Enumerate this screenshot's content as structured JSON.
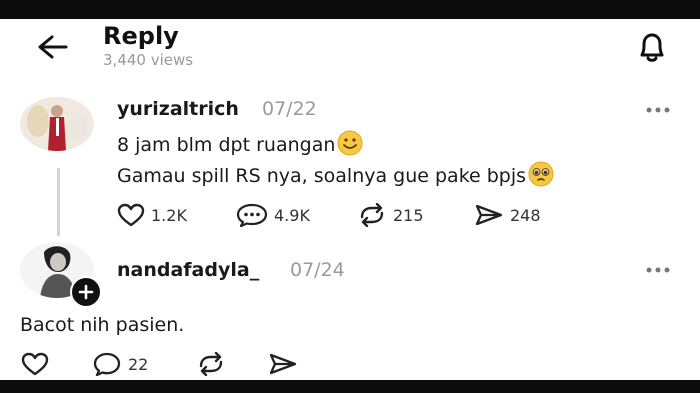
{
  "header": {
    "title": "Reply",
    "views": "3,440 views"
  },
  "post": {
    "username": "yurizaltrich",
    "date": "07/22",
    "line1": "8 jam blm dpt ruangan",
    "line2": "Gamau spill RS nya, soalnya gue pake bpjs",
    "likes": "1.2K",
    "comments": "4.9K",
    "reposts": "215",
    "shares": "248"
  },
  "reply": {
    "username": "nandafadyla_",
    "date": "07/24",
    "text": "Bacot nih pasien.",
    "comments": "22"
  },
  "icons": {
    "back": "arrow-left-icon",
    "notify": "bell-icon",
    "more": "more-dots-icon",
    "like": "heart-icon",
    "comment": "comment-icon",
    "repost": "repost-icon",
    "share": "send-icon"
  },
  "colors": {
    "text": "#111111",
    "muted": "#999999",
    "bars": "#0c0c0c"
  }
}
